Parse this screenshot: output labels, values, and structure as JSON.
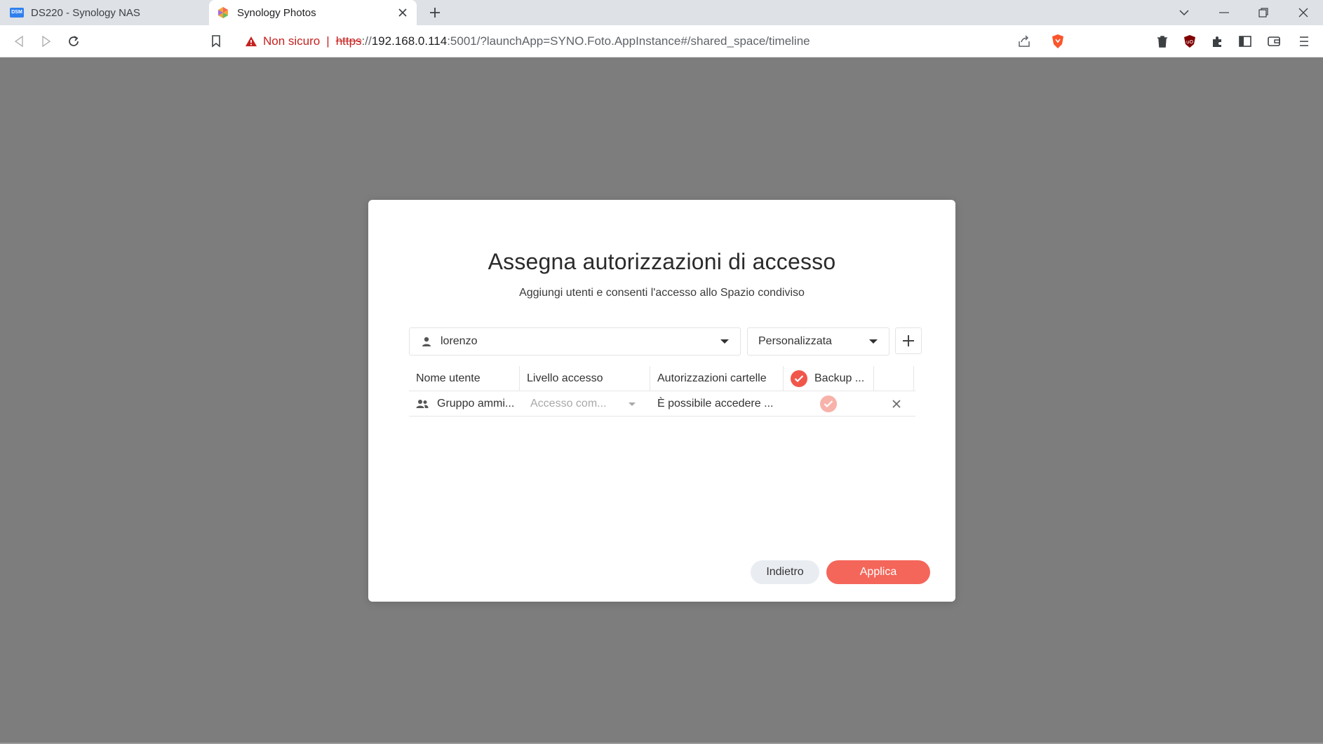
{
  "browser": {
    "tabs": [
      {
        "title": "DS220 - Synology NAS",
        "favicon": "dsm-icon",
        "favicon_text": "DSM",
        "active": false
      },
      {
        "title": "Synology Photos",
        "favicon": "synology-photos-icon",
        "active": true
      }
    ],
    "security_label": "Non sicuro",
    "url": {
      "scheme": "https",
      "rest": "://",
      "host": "192.168.0.114",
      "path": ":5001/?launchApp=SYNO.Foto.AppInstance#/shared_space/timeline"
    }
  },
  "dialog": {
    "title": "Assegna autorizzazioni di accesso",
    "subtitle": "Aggiungi utenti e consenti l'accesso allo Spazio condiviso",
    "user_select": {
      "value": "lorenzo"
    },
    "role_select": {
      "value": "Personalizzata"
    },
    "table": {
      "headers": {
        "username": "Nome utente",
        "access_level": "Livello accesso",
        "folder_permissions": "Autorizzazioni cartelle",
        "backup": "Backup ..."
      },
      "rows": [
        {
          "username": "Gruppo ammi...",
          "access_level": "Accesso com...",
          "folder_permissions": "È possibile accedere ..."
        }
      ]
    },
    "buttons": {
      "back": "Indietro",
      "apply": "Applica"
    }
  },
  "colors": {
    "accent": "#f4665a",
    "overlay": "#7d7d7d",
    "warning": "#c5221f"
  }
}
